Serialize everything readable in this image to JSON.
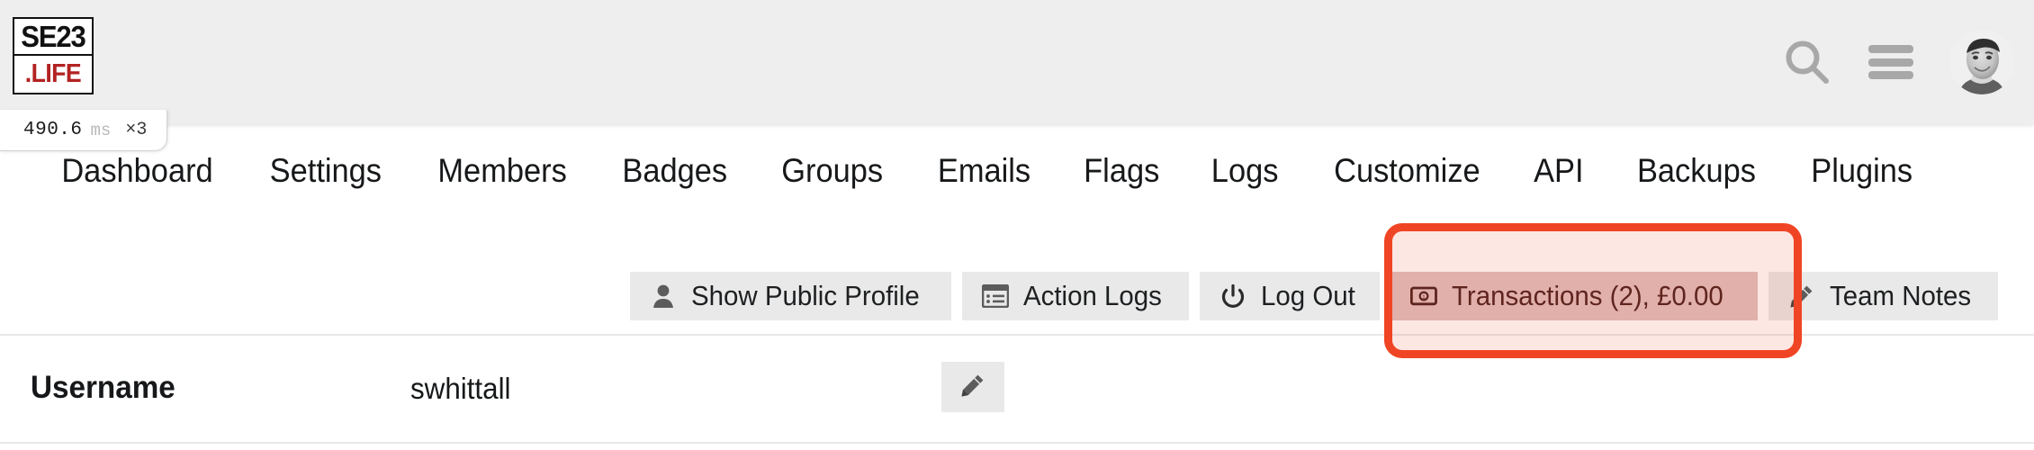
{
  "header": {
    "logo": {
      "top_text": "SE23",
      "bottom_text": ".LIFE",
      "icon": "se23-life-logo"
    },
    "search_icon": "search-icon",
    "menu_icon": "hamburger-menu-icon",
    "avatar_icon": "user-avatar-photo"
  },
  "perf_badge": {
    "value": "490.6",
    "unit": "ms",
    "multiplier": "×3"
  },
  "nav": {
    "items": [
      {
        "label": "Dashboard"
      },
      {
        "label": "Settings"
      },
      {
        "label": "Members"
      },
      {
        "label": "Badges"
      },
      {
        "label": "Groups"
      },
      {
        "label": "Emails"
      },
      {
        "label": "Flags"
      },
      {
        "label": "Logs"
      },
      {
        "label": "Customize"
      },
      {
        "label": "API"
      },
      {
        "label": "Backups"
      },
      {
        "label": "Plugins"
      }
    ]
  },
  "actions": {
    "buttons": [
      {
        "label": "Show Public Profile",
        "icon": "person-icon"
      },
      {
        "label": "Action Logs",
        "icon": "list-window-icon"
      },
      {
        "label": "Log Out",
        "icon": "power-icon"
      },
      {
        "label": "Transactions (2), £0.00",
        "icon": "banknote-icon"
      },
      {
        "label": "Team Notes",
        "icon": "pencil-icon"
      }
    ]
  },
  "highlight": {
    "target": "Transactions (2), £0.00",
    "color": "#f04524"
  },
  "field": {
    "label": "Username",
    "value": "swhittall",
    "edit_icon": "pencil-icon"
  }
}
